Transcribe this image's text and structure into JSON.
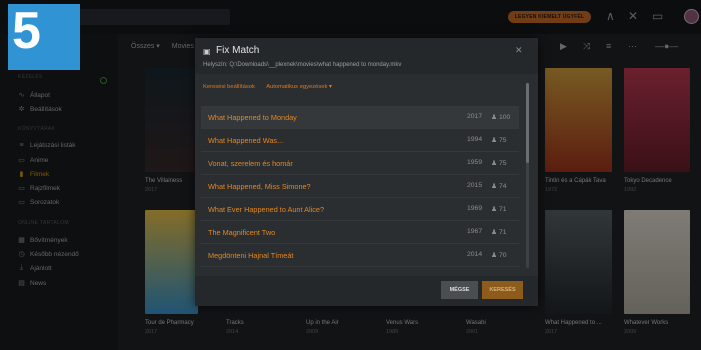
{
  "badge": {
    "number": "5"
  },
  "topbar": {
    "premium_label": "LEGYEN KIEMELT ÜGYFÉL"
  },
  "sidebar": {
    "section1": "KEZELÉS",
    "item_allapot": "Állapot",
    "item_beallitasok": "Beállítások",
    "section2": "KÖNYVTÁRAK",
    "item_lejatszasi": "Lejátszási listák",
    "item_anime": "Anime",
    "item_filmek": "Filmek",
    "item_rajzfilmek": "Rajzfilmek",
    "item_sorozatok": "Sorozatok",
    "section3": "ONLINE TARTALOM",
    "item_bovitmenyek": "Bővítmények",
    "item_kesobb": "Később nézendő",
    "item_ajanlott": "Ajánlott",
    "item_news": "News"
  },
  "toolbar": {
    "tab_all": "Összes ▾",
    "tab_movies": "Movies"
  },
  "posters": {
    "p1_title": "The Villainess",
    "p1_year": "2017",
    "p2_title": "Tintin és a Cápák Tava",
    "p2_year": "1972",
    "p3_title": "Tokyo Decadence",
    "p3_year": "1992",
    "p4_title": "Tour de Pharmacy",
    "p4_year": "2017",
    "p5_title": "Tracks",
    "p5_year": "2014",
    "p6_title": "Up in the Air",
    "p6_year": "2009",
    "p7_title": "Venus Wars",
    "p7_year": "1989",
    "p8_title": "Wasabi",
    "p8_year": "2001",
    "p9_title": "What Happened to ...",
    "p9_year": "2017",
    "p10_title": "Whatever Works",
    "p10_year": "2009"
  },
  "modal": {
    "title": "Fix Match",
    "path": "Helyszín: Q:\\Downloads\\__plexnek\\movies\\what happened to monday.mkv",
    "filter1": "Keresési beállítások",
    "filter2": "Automatikus egyezések ▾",
    "cancel_label": "MÉGSE",
    "search_label": "KERESÉS"
  },
  "results": [
    {
      "title": "What Happened to Monday",
      "year": "2017",
      "score": "100"
    },
    {
      "title": "What Happened Was...",
      "year": "1994",
      "score": "75"
    },
    {
      "title": "Vonat, szerelem és homár",
      "year": "1959",
      "score": "75"
    },
    {
      "title": "What Happened, Miss Simone?",
      "year": "2015",
      "score": "74"
    },
    {
      "title": "What Ever Happened to Aunt Alice?",
      "year": "1969",
      "score": "71"
    },
    {
      "title": "The Magnificent Two",
      "year": "1967",
      "score": "71"
    },
    {
      "title": "Megdönteni Hajnal Tímeát",
      "year": "2014",
      "score": "70"
    }
  ]
}
